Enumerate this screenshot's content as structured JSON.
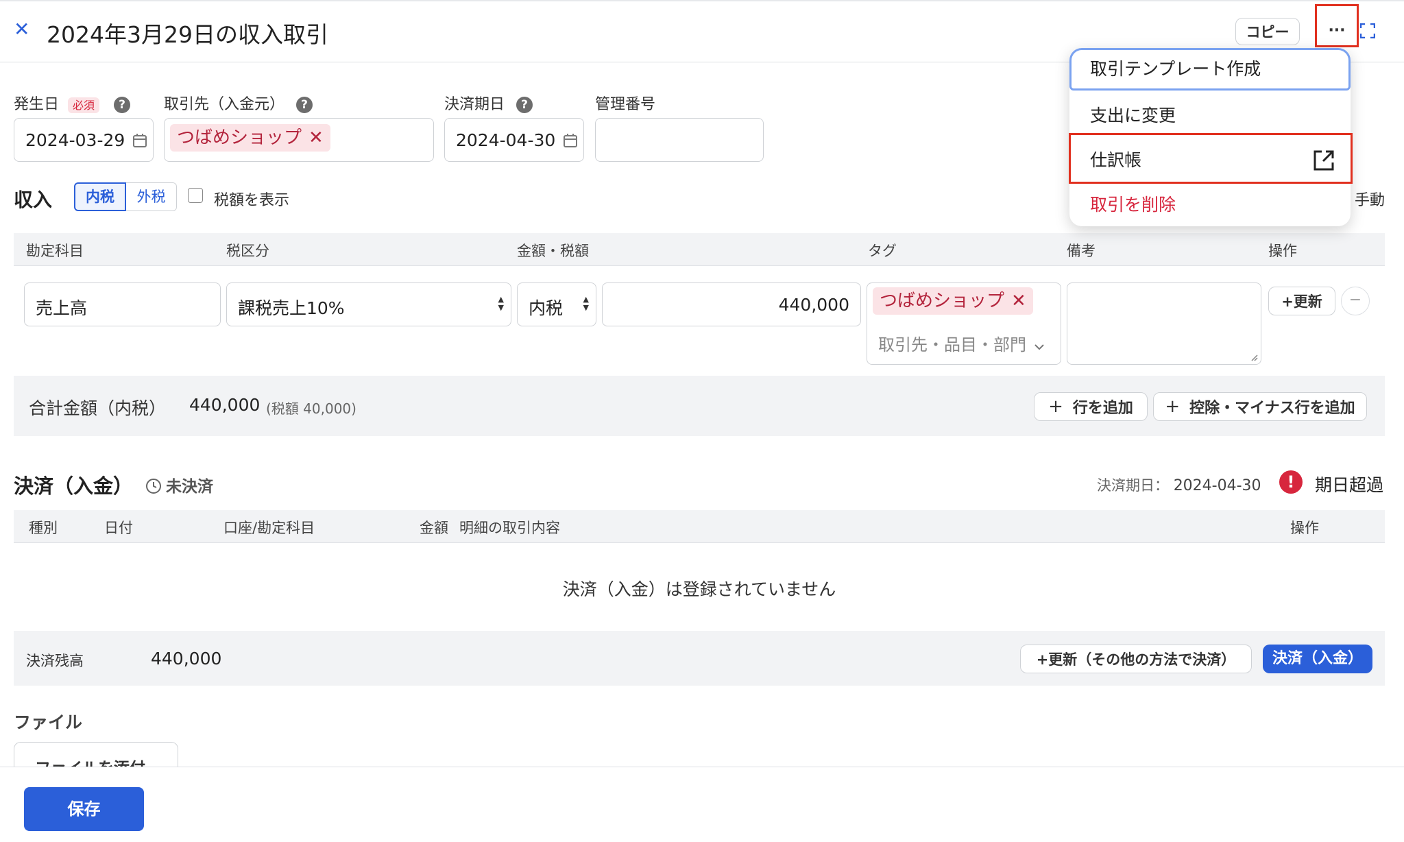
{
  "header": {
    "close_glyph": "✕",
    "title": "2024年3月29日の収入取引",
    "copy_label": "コピー",
    "more_glyph": "···",
    "expand_glyph": "⛶"
  },
  "fields": {
    "date_label": "発生日",
    "required_badge": "必須",
    "date_value": "2024-03-29",
    "partner_label": "取引先（入金元）",
    "partner_tag": "つばめショップ",
    "due_label": "決済期日",
    "due_value": "2024-04-30",
    "manage_label": "管理番号",
    "manage_value": ""
  },
  "income": {
    "title": "収入",
    "tax_incl": "内税",
    "tax_excl": "外税",
    "show_tax_label": "税額を表示",
    "manual_label": "手動"
  },
  "table": {
    "headers": [
      "勘定科目",
      "税区分",
      "金額・税額",
      "タグ",
      "備考",
      "操作"
    ],
    "row": {
      "account": "売上高",
      "tax_category": "課税売上10%",
      "tax_mode": "内税",
      "amount": "440,000",
      "tag": "つばめショップ",
      "tag_placeholder": "取引先・品目・部門",
      "note": "",
      "update_label": "+更新",
      "remove_glyph": "−"
    },
    "total_label": "合計金額（内税）",
    "total_value": "440,000",
    "total_tax": "(税額 40,000)",
    "add_row": "行を追加",
    "add_minus_row": "控除・マイナス行を追加"
  },
  "settlement": {
    "title": "決済（入金）",
    "status": "未決済",
    "due_label": "決済期日：",
    "due_value": "2024-04-30",
    "overdue_label": "期日超過",
    "headers": [
      "種別",
      "日付",
      "口座/勘定科目",
      "金額",
      "明細の取引内容",
      "操作"
    ],
    "empty_message": "決済（入金）は登録されていません",
    "balance_label": "決済残高",
    "balance_value": "440,000",
    "update_other": "+更新（その他の方法で決済）",
    "settle_button": "決済（入金）"
  },
  "file": {
    "title": "ファイル",
    "attach_label": "ファイルを添付"
  },
  "footer": {
    "save_label": "保存"
  },
  "menu": {
    "items": [
      "取引テンプレート作成",
      "支出に変更",
      "仕訳帳",
      "取引を削除"
    ]
  },
  "colors": {
    "accent_blue": "#2b5fd9",
    "highlight_red": "#e1301f",
    "danger_red": "#d7263d",
    "tag_bg": "#fbe3e6"
  }
}
